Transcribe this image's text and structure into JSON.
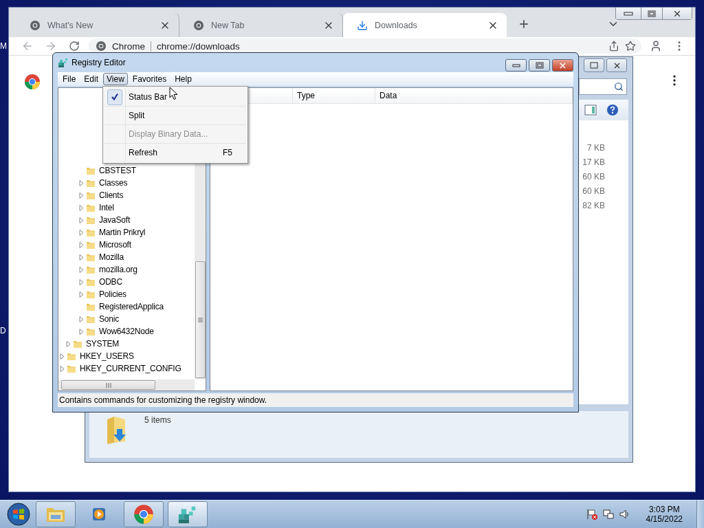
{
  "desktop": {
    "edge_labels": [
      "M",
      "D"
    ]
  },
  "browser": {
    "tabs": [
      {
        "title": "What's New",
        "selected": false
      },
      {
        "title": "New Tab",
        "selected": false
      },
      {
        "title": "Downloads",
        "selected": true
      }
    ],
    "address": {
      "origin": "Chrome",
      "url": "chrome://downloads"
    }
  },
  "explorer": {
    "sizes": [
      "7 KB",
      "17 KB",
      "60 KB",
      "60 KB",
      "82 KB"
    ],
    "details": "5 items"
  },
  "regedit": {
    "title": "Registry Editor",
    "menu": [
      {
        "label": "File",
        "selected": false
      },
      {
        "label": "Edit",
        "selected": false
      },
      {
        "label": "View",
        "selected": true
      },
      {
        "label": "Favorites",
        "selected": false
      },
      {
        "label": "Help",
        "selected": false
      }
    ],
    "dropdown": [
      {
        "label": "Status Bar",
        "checked": true,
        "disabled": false
      },
      {
        "label": "Split",
        "checked": false,
        "disabled": false
      },
      {
        "label": "Display Binary Data...",
        "checked": false,
        "disabled": true
      },
      {
        "label": "Refresh",
        "shortcut": "F5",
        "checked": false,
        "disabled": false
      }
    ],
    "columns": [
      "Type",
      "Data"
    ],
    "tree": [
      {
        "children": [
          {
            "children": [
              {
                "label": "CBSTEST",
                "expandable": false
              },
              {
                "label": "Classes",
                "expandable": true,
                "expanded": false
              },
              {
                "label": "Clients",
                "expandable": true,
                "expanded": false
              },
              {
                "label": "Intel",
                "expandable": true,
                "expanded": false
              },
              {
                "label": "JavaSoft",
                "expandable": true,
                "expanded": false
              },
              {
                "label": "Martin Prikryl",
                "expandable": true,
                "expanded": false
              },
              {
                "label": "Microsoft",
                "expandable": true,
                "expanded": false
              },
              {
                "label": "Mozilla",
                "expandable": true,
                "expanded": false
              },
              {
                "label": "mozilla.org",
                "expandable": true,
                "expanded": false
              },
              {
                "label": "ODBC",
                "expandable": true,
                "expanded": false
              },
              {
                "label": "Policies",
                "expandable": true,
                "expanded": false
              },
              {
                "label": "RegisteredApplica",
                "expandable": false
              },
              {
                "label": "Sonic",
                "expandable": true,
                "expanded": false
              },
              {
                "label": "Wow6432Node",
                "expandable": true,
                "expanded": false
              }
            ]
          },
          {
            "label": "SYSTEM",
            "expandable": true,
            "expanded": false
          }
        ]
      },
      {
        "label": "HKEY_USERS",
        "expandable": true,
        "expanded": false
      },
      {
        "label": "HKEY_CURRENT_CONFIG",
        "expandable": true,
        "expanded": false
      }
    ],
    "status": "Contains commands for customizing the registry window."
  },
  "taskbar": {
    "buttons": [
      {
        "kind": "explorer",
        "running": true,
        "selected": false
      },
      {
        "kind": "media",
        "running": false,
        "selected": false
      },
      {
        "kind": "chrome",
        "running": true,
        "selected": false
      },
      {
        "kind": "regedit",
        "running": true,
        "selected": true
      }
    ],
    "time": "3:03 PM",
    "date": "4/15/2022"
  }
}
